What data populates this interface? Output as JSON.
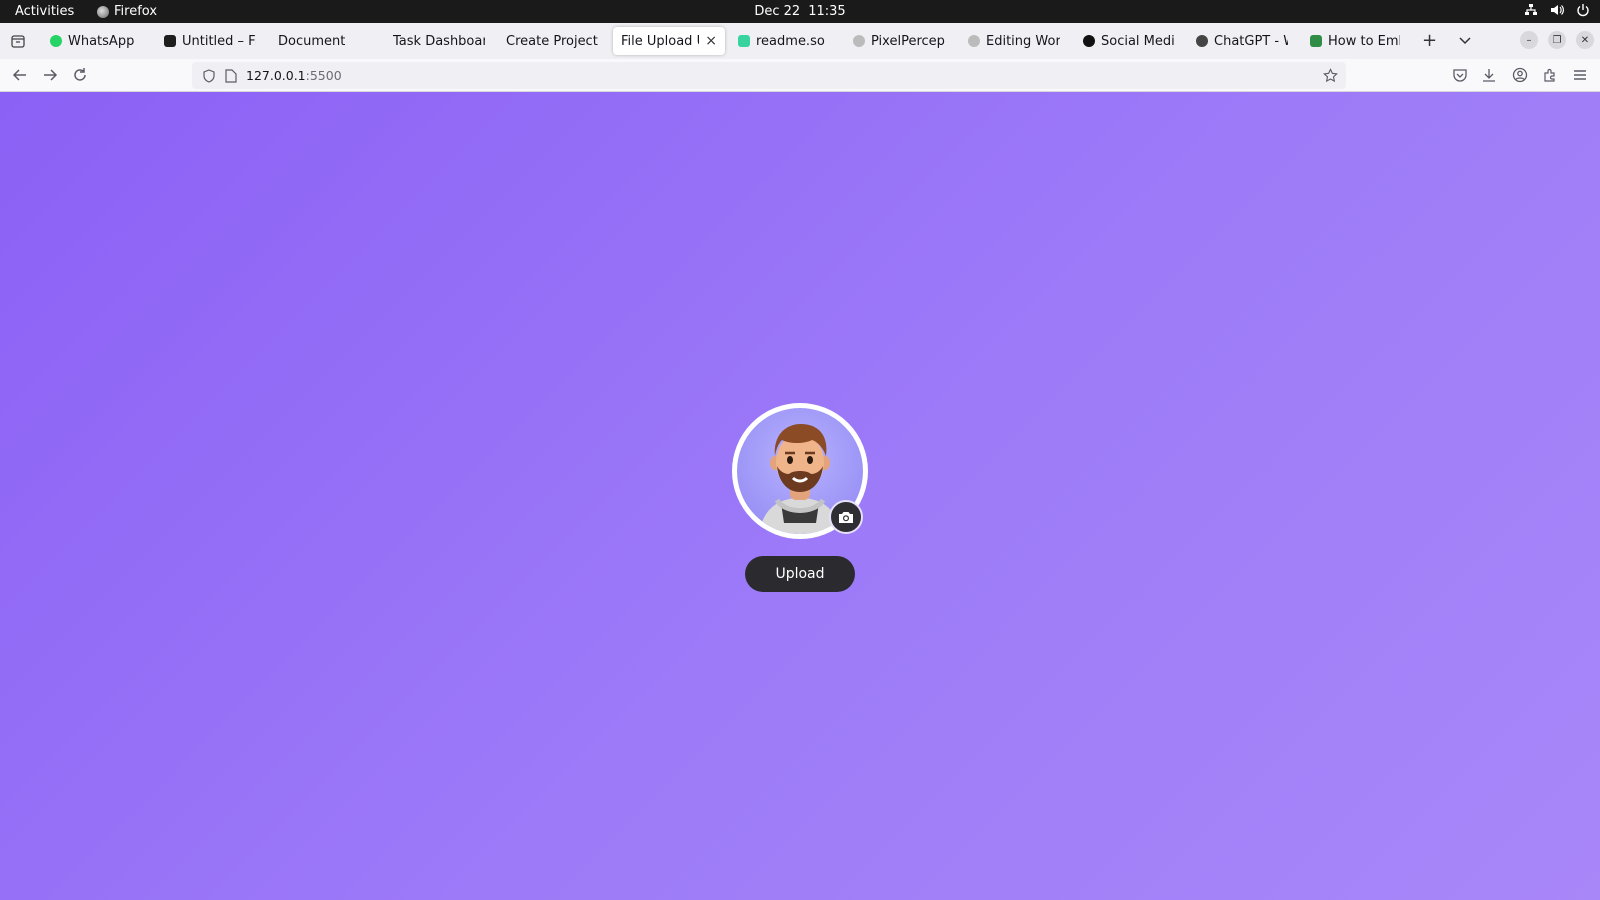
{
  "system_bar": {
    "activities": "Activities",
    "app_name": "Firefox",
    "date": "Dec 22",
    "time": "11:35",
    "tray_icons": [
      "network-icon",
      "volume-icon",
      "power-icon"
    ]
  },
  "tabs": [
    {
      "label": "WhatsApp",
      "icon": "whatsapp-icon",
      "color": "#25d366"
    },
    {
      "label": "Untitled – Fig",
      "icon": "figma-icon",
      "color": "#1e1e1e"
    },
    {
      "label": "Document",
      "icon": "",
      "color": ""
    },
    {
      "label": "Task Dashboard",
      "icon": "",
      "color": ""
    },
    {
      "label": "Create Project",
      "icon": "",
      "color": ""
    },
    {
      "label": "File Upload UI",
      "icon": "",
      "color": "",
      "active": true
    },
    {
      "label": "readme.so",
      "icon": "readme-icon",
      "color": "#38d39f"
    },
    {
      "label": "PixelPercept",
      "icon": "github-icon",
      "color": "#bbbbbb"
    },
    {
      "label": "Editing Work",
      "icon": "github-icon",
      "color": "#bbbbbb"
    },
    {
      "label": "Social Media",
      "icon": "threads-icon",
      "color": "#111111"
    },
    {
      "label": "ChatGPT - Wr",
      "icon": "openai-icon",
      "color": "#444444"
    },
    {
      "label": "How to Embe",
      "icon": "gfg-icon",
      "color": "#2f8d46"
    }
  ],
  "tab_close_glyph": "×",
  "new_tab_glyph": "+",
  "url": {
    "host": "127.0.0.1",
    "port": ":5500"
  },
  "page": {
    "upload_label": "Upload",
    "background_from": "#8b60f5",
    "background_to": "#a887f9",
    "avatar": "memoji-avatar-man-with-beard"
  }
}
